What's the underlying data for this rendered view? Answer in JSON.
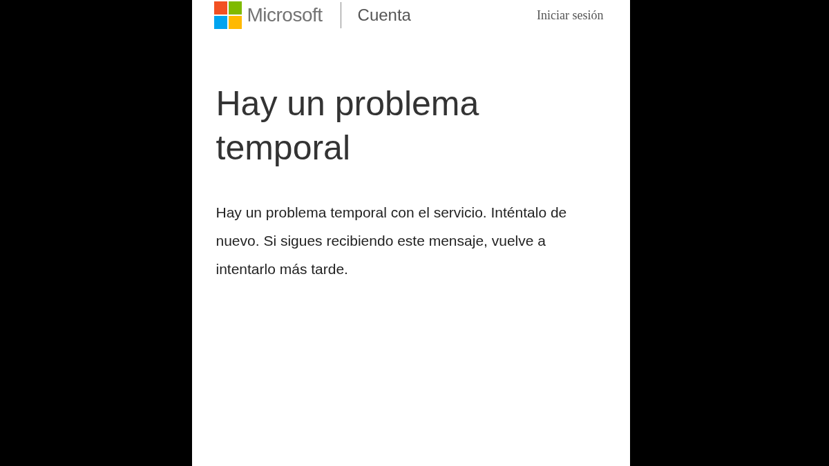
{
  "header": {
    "brand": "Microsoft",
    "section": "Cuenta",
    "sign_in": "Iniciar sesión"
  },
  "title": "Hay un problema temporal",
  "message": "Hay un problema temporal con el servicio. Inténtalo de nuevo. Si sigues recibiendo este mensaje, vuelve a intentarlo más tarde."
}
